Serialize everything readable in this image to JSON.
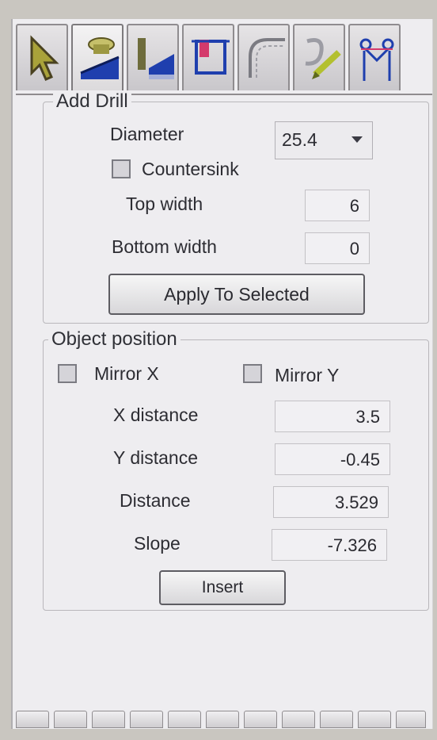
{
  "tabs": [
    {
      "icon": "select-arrow-icon",
      "active": false
    },
    {
      "icon": "drill-icon",
      "active": true
    },
    {
      "icon": "drill-bit-icon",
      "active": false
    },
    {
      "icon": "pocket-icon",
      "active": false
    },
    {
      "icon": "fillet-icon",
      "active": false
    },
    {
      "icon": "pencil-icon",
      "active": false
    },
    {
      "icon": "caliper-icon",
      "active": false
    }
  ],
  "add_drill": {
    "legend": "Add Drill",
    "diameter_label": "Diameter",
    "diameter_value": "25.4",
    "countersink_label": "Countersink",
    "countersink_checked": false,
    "top_width_label": "Top width",
    "top_width_value": "6",
    "bottom_width_label": "Bottom width",
    "bottom_width_value": "0",
    "apply_button": "Apply To Selected"
  },
  "object_position": {
    "legend": "Object position",
    "mirror_x_label": "Mirror X",
    "mirror_x_checked": false,
    "mirror_y_label": "Mirror Y",
    "mirror_y_checked": false,
    "x_distance_label": "X distance",
    "x_distance_value": "3.5",
    "y_distance_label": "Y distance",
    "y_distance_value": "-0.45",
    "distance_label": "Distance",
    "distance_value": "3.529",
    "slope_label": "Slope",
    "slope_value": "-7.326",
    "insert_button": "Insert"
  },
  "colors": {
    "accent_blue": "#1f3fae",
    "panel_bg": "#eeedf0",
    "active_icon_green": "#b3c02f"
  }
}
